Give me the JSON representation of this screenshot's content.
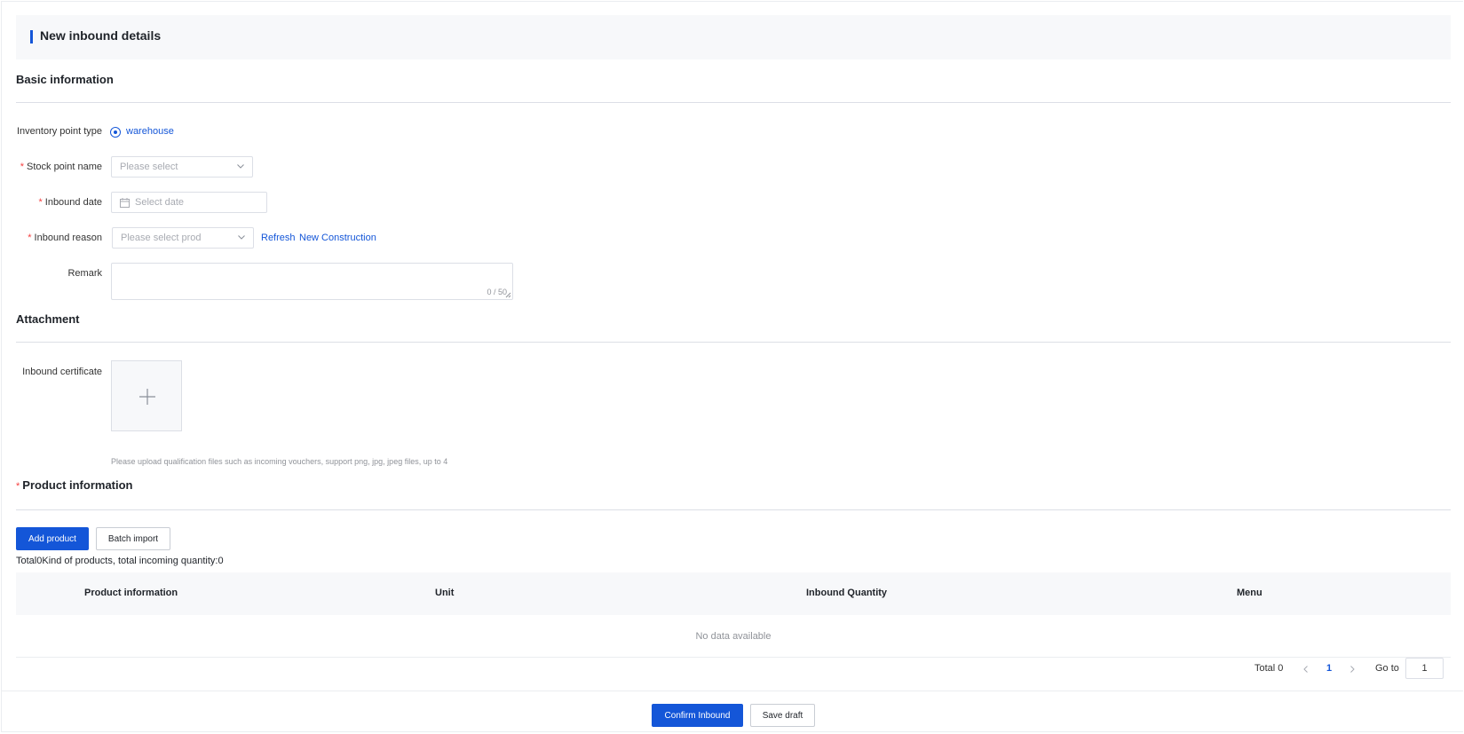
{
  "header": {
    "title": "New inbound details"
  },
  "basic_info": {
    "section_title": "Basic information",
    "inventory_point_type": {
      "label": "Inventory point type",
      "option": "warehouse"
    },
    "stock_point_name": {
      "label": "Stock point name",
      "placeholder": "Please select"
    },
    "inbound_date": {
      "label": "Inbound date",
      "placeholder": "Select date"
    },
    "inbound_reason": {
      "label": "Inbound reason",
      "placeholder": "Please select prod",
      "refresh_link": "Refresh",
      "new_link": "New Construction"
    },
    "remark": {
      "label": "Remark",
      "counter": "0 / 50"
    }
  },
  "attachment": {
    "section_title": "Attachment",
    "certificate_label": "Inbound certificate",
    "upload_hint": "Please upload qualification files such as incoming vouchers, support png, jpg, jpeg files, up to 4"
  },
  "product_info": {
    "section_title": "Product information",
    "add_button": "Add product",
    "batch_button": "Batch import",
    "summary": "Total0Kind of products, total incoming quantity:0",
    "columns": [
      "Product information",
      "Unit",
      "Inbound Quantity",
      "Menu"
    ],
    "empty_text": "No data available"
  },
  "pagination": {
    "total": "Total 0",
    "current_page": "1",
    "goto_label": "Go to",
    "goto_value": "1"
  },
  "footer": {
    "confirm_button": "Confirm Inbound",
    "draft_button": "Save draft"
  },
  "colors": {
    "primary": "#1456d8",
    "required": "#f53f3f",
    "header_bg": "#f7f8fa"
  }
}
